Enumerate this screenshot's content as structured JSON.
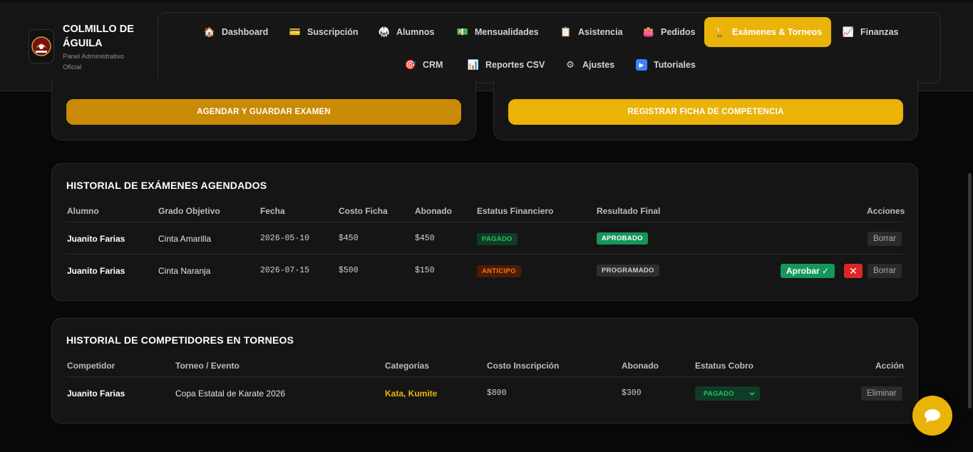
{
  "brand": {
    "title": "COLMILLO DE ÁGUILA",
    "subtitle": "Panel Administrativo Oficial"
  },
  "nav": [
    {
      "label": "Dashboard",
      "icon": "house-icon"
    },
    {
      "label": "Suscripción",
      "icon": "card-icon"
    },
    {
      "label": "Alumnos",
      "icon": "gi-icon"
    },
    {
      "label": "Mensualidades",
      "icon": "money-icon"
    },
    {
      "label": "Asistencia",
      "icon": "clipboard-icon"
    },
    {
      "label": "Pedidos",
      "icon": "bag-icon"
    },
    {
      "label": "Exámenes & Torneos",
      "icon": "trophy-icon",
      "active": true
    },
    {
      "label": "Finanzas",
      "icon": "chart-icon"
    },
    {
      "label": "CRM",
      "icon": "target-icon"
    },
    {
      "label": "Reportes CSV",
      "icon": "bar-chart-icon"
    },
    {
      "label": "Ajustes",
      "icon": "gear-icon"
    },
    {
      "label": "Tutoriales",
      "icon": "play-icon"
    }
  ],
  "actions": {
    "exam_button": "AGENDAR Y GUARDAR EXAMEN",
    "competition_button": "REGISTRAR FICHA DE COMPETENCIA"
  },
  "exams": {
    "title": "HISTORIAL DE EXÁMENES AGENDADOS",
    "columns": [
      "Alumno",
      "Grado Objetivo",
      "Fecha",
      "Costo Ficha",
      "Abonado",
      "Estatus Financiero",
      "Resultado Final",
      "Acciones"
    ],
    "rows": [
      {
        "alumno": "Juanito Farias",
        "grado": "Cinta Amarilla",
        "fecha": "2026-05-10",
        "costo": "$450",
        "abonado": "$450",
        "estatus": "PAGADO",
        "resultado": "APROBADO",
        "borrar": "Borrar"
      },
      {
        "alumno": "Juanito Farias",
        "grado": "Cinta Naranja",
        "fecha": "2026-07-15",
        "costo": "$500",
        "abonado": "$150",
        "estatus": "ANTICIPO",
        "resultado": "PROGRAMADO",
        "aprobar": "Aprobar ✓",
        "reject": "✕",
        "borrar": "Borrar"
      }
    ]
  },
  "tournaments": {
    "title": "HISTORIAL DE COMPETIDORES EN TORNEOS",
    "columns": [
      "Competidor",
      "Torneo / Evento",
      "Categorías",
      "Costo Inscripción",
      "Abonado",
      "Estatus Cobro",
      "Acción"
    ],
    "rows": [
      {
        "competidor": "Juanito Farias",
        "torneo": "Copa Estatal de Karate 2026",
        "categorias": "Kata, Kumite",
        "costo": "$800",
        "abonado": "$300",
        "estatus": "PAGADO",
        "accion": "Eliminar"
      }
    ]
  },
  "colors": {
    "accent": "#eab308",
    "accent_dark": "#c98a06",
    "green": "#16a34a",
    "red": "#dc2626"
  }
}
